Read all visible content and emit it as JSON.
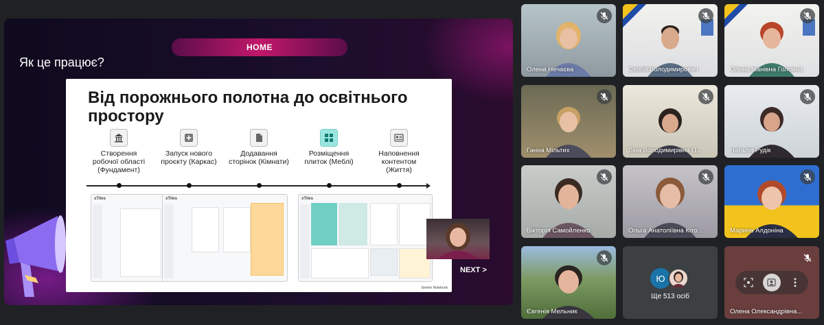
{
  "presentation": {
    "home_label": "HOME",
    "question": "Як це працює?",
    "slide_title": "Від порожнього полотна до освітнього простору",
    "steps": [
      {
        "label": "Створення робочої області (Фундамент)",
        "icon": "bank-icon"
      },
      {
        "label": "Запуск нового проєкту (Каркас)",
        "icon": "plus-icon"
      },
      {
        "label": "Додавання сторінок (Кімнати)",
        "icon": "document-icon"
      },
      {
        "label": "Розміщення плиток (Меблі)",
        "icon": "tiles-icon"
      },
      {
        "label": "Наповнення контентом (Життя)",
        "icon": "content-icon"
      }
    ],
    "screenshot_brand": "xTiles",
    "footer_note": "Gemini Notebook",
    "next_label": "NEXT >"
  },
  "participants": [
    {
      "name": "Олена Нечаєва",
      "muted": true
    },
    {
      "name": "Сергій Володимирович",
      "muted": true
    },
    {
      "name": "Олена Іванівна Головна",
      "muted": true
    },
    {
      "name": "Ганна Мільтих",
      "muted": true
    },
    {
      "name": "Ліна Володимирівна П...",
      "muted": true
    },
    {
      "name": "Наталія Рудік",
      "muted": true
    },
    {
      "name": "Вікторія Самойленко",
      "muted": true
    },
    {
      "name": "Ольга Анатоліївна Кіто...",
      "muted": true
    },
    {
      "name": "Марина Алдоніна",
      "muted": true
    },
    {
      "name": "Євгенія Мельник",
      "muted": true
    },
    {
      "name": "Олена Олександрівна...",
      "muted": true
    }
  ],
  "more": {
    "avatar_letter": "Ю",
    "label": "Ще 513 осіб"
  },
  "colors": {
    "accent": "#c2186a",
    "tile_bg": "#3c4043"
  }
}
